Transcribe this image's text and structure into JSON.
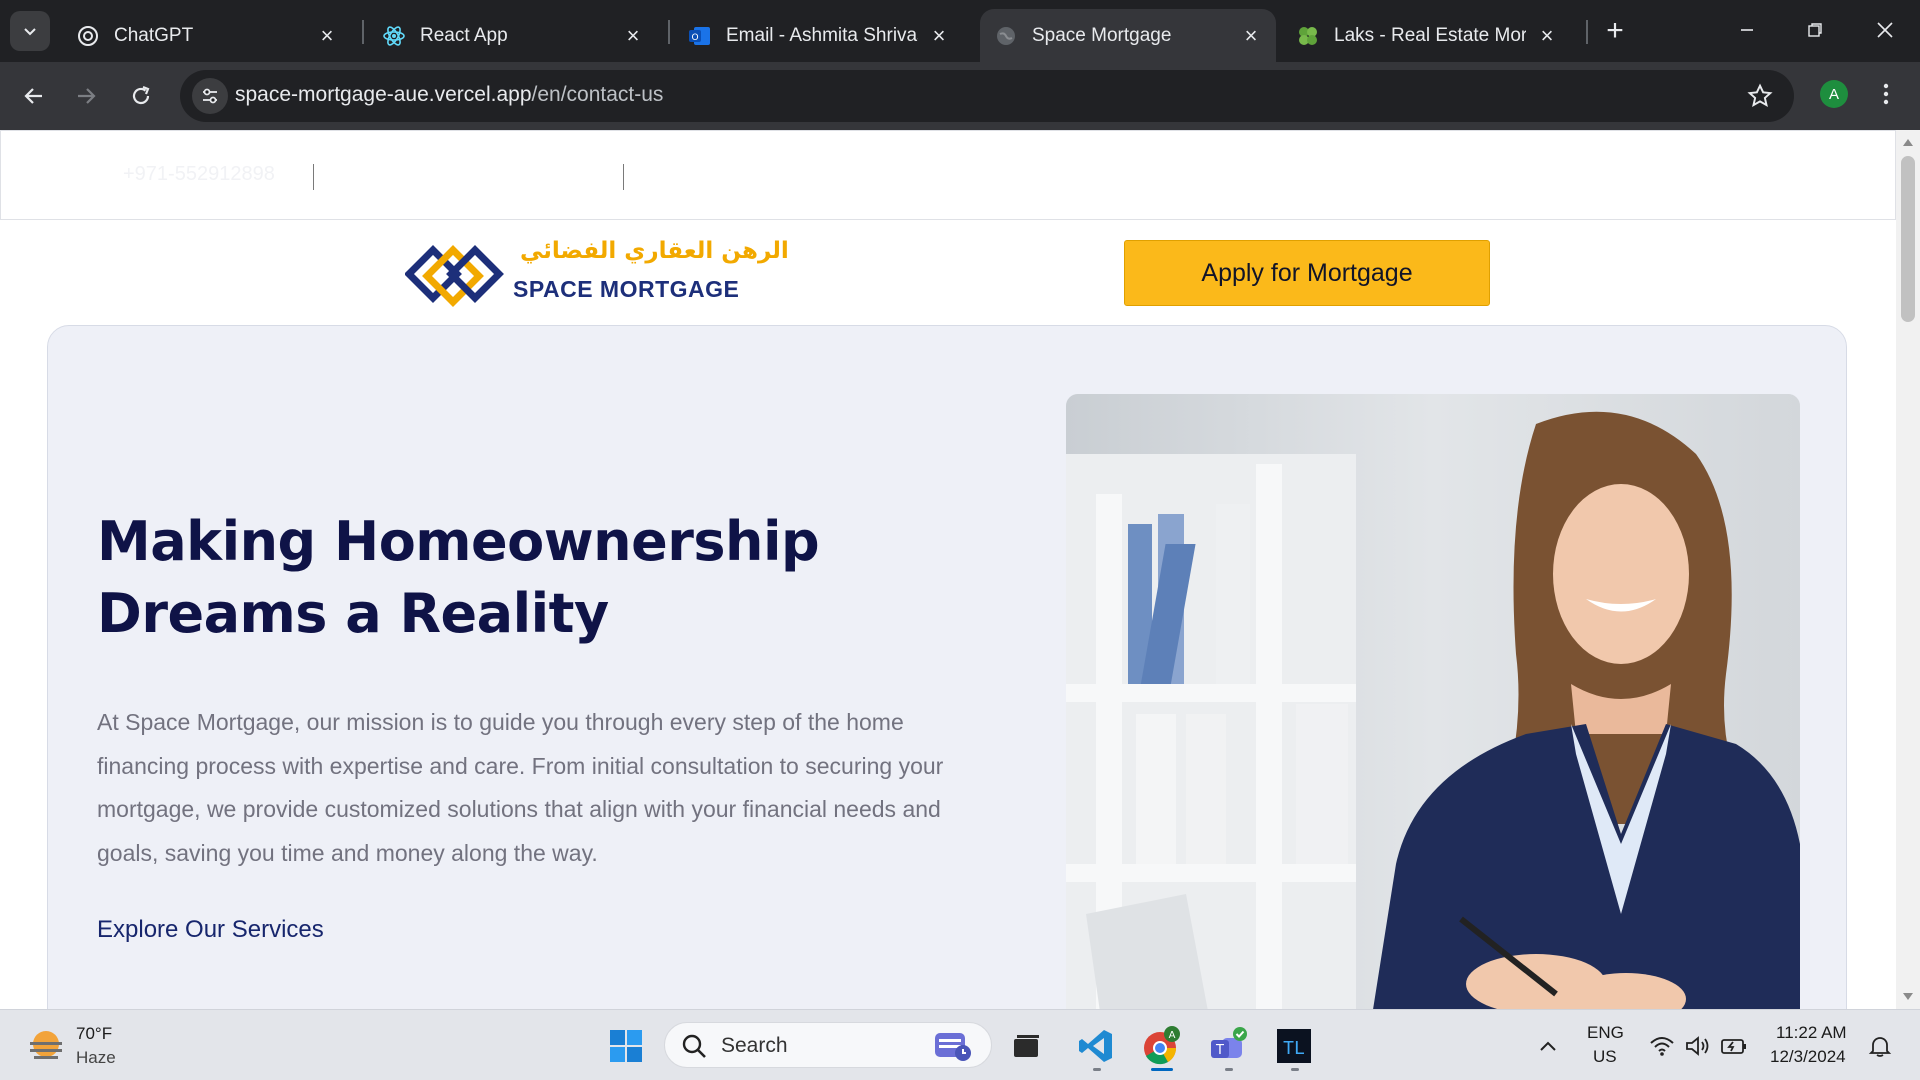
{
  "browser": {
    "tabs": [
      {
        "title": "ChatGPT",
        "icon": "chatgpt-icon"
      },
      {
        "title": "React App",
        "icon": "react-icon"
      },
      {
        "title": "Email - Ashmita Shrivas -",
        "icon": "outlook-icon"
      },
      {
        "title": "Space Mortgage",
        "icon": "globe-icon",
        "active": true
      },
      {
        "title": "Laks - Real Estate Mortga",
        "icon": "laks-icon"
      }
    ],
    "url_host": "space-mortgage-aue.vercel.app",
    "url_path": "/en/contact-us",
    "profile_initial": "A"
  },
  "page": {
    "phone": "+971-552912898",
    "logo_arabic": "الرهن العقاري الفضائي",
    "logo_english": "SPACE MORTGAGE",
    "apply_button": "Apply for Mortgage",
    "hero_title": "Making Homeownership Dreams a Reality",
    "hero_text": "At Space Mortgage, our mission is to guide you through every step of the home financing process with expertise and care. From initial consultation to securing your mortgage, we provide customized solutions that align with your financial needs and goals, saving you time and money along the way.",
    "hero_link": "Explore Our Services",
    "colors": {
      "brand_navy": "#0f1347",
      "brand_yellow": "#fbb91a",
      "hero_bg": "#eef0f7"
    }
  },
  "taskbar": {
    "weather_temp": "70°F",
    "weather_desc": "Haze",
    "search_placeholder": "Search",
    "language_line1": "ENG",
    "language_line2": "US",
    "time": "11:22 AM",
    "date": "12/3/2024",
    "chrome_badge": "A"
  }
}
